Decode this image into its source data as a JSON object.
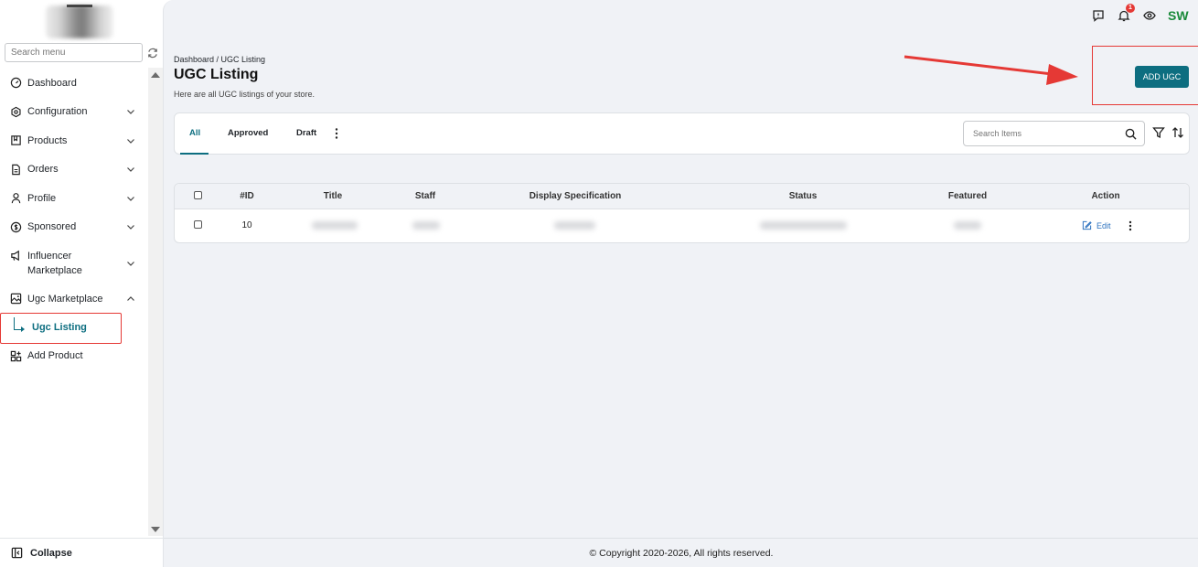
{
  "sidebar": {
    "search_placeholder": "Search menu",
    "items": [
      {
        "label": "Dashboard"
      },
      {
        "label": "Configuration"
      },
      {
        "label": "Products"
      },
      {
        "label": "Orders"
      },
      {
        "label": "Profile"
      },
      {
        "label": "Sponsored"
      },
      {
        "label": "Influencer Marketplace"
      },
      {
        "label": "Ugc Marketplace"
      }
    ],
    "sub_item": {
      "label": "Ugc Listing"
    },
    "add_product": {
      "label": "Add Product"
    },
    "collapse_label": "Collapse"
  },
  "header": {
    "notification_count": "1",
    "avatar_initials": "SW"
  },
  "page": {
    "breadcrumb": "Dashboard / UGC Listing",
    "title": "UGC Listing",
    "subtitle": "Here are all UGC listings of your store.",
    "add_button": "ADD UGC"
  },
  "tabs": [
    {
      "label": "All",
      "active": true
    },
    {
      "label": "Approved",
      "active": false
    },
    {
      "label": "Draft",
      "active": false
    }
  ],
  "search": {
    "placeholder": "Search Items"
  },
  "table": {
    "columns": [
      "#ID",
      "Title",
      "Staff",
      "Display Specification",
      "Status",
      "Featured",
      "Action"
    ],
    "rows": [
      {
        "id": "10",
        "edit_label": "Edit"
      }
    ]
  },
  "footer": {
    "copyright": "© Copyright 2020-2026, All rights reserved."
  },
  "colors": {
    "accent": "#0d6e80",
    "annotation_red": "#e53935"
  }
}
